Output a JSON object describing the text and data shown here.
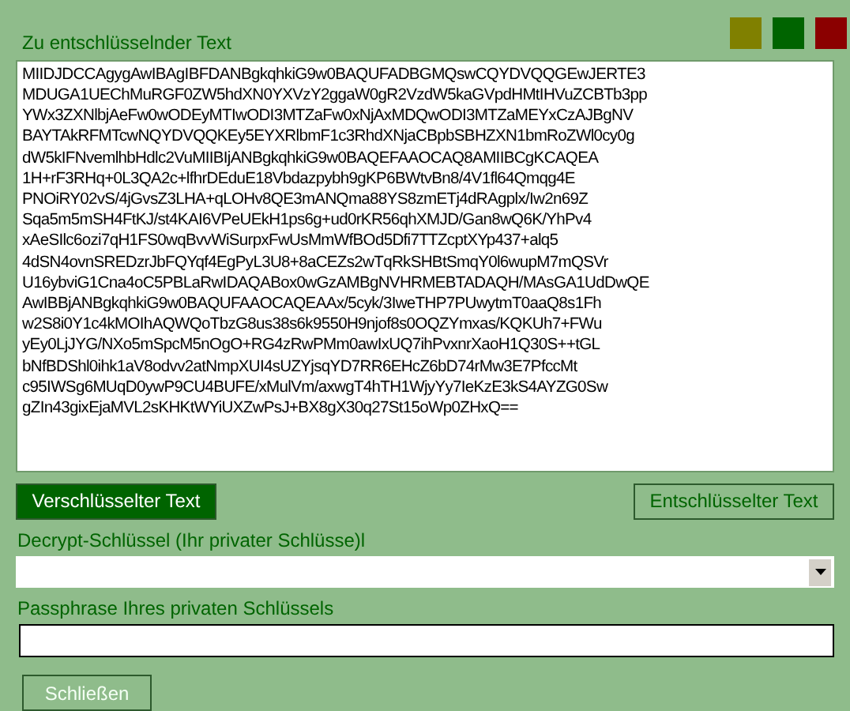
{
  "header": {
    "label": "Zu entschlüsselnder Text"
  },
  "swatches": [
    {
      "color": "#808000"
    },
    {
      "color": "#006400"
    },
    {
      "color": "#8b0000"
    }
  ],
  "text_lines": [
    "MIIDJDCCAgygAwIBAgIBFDANBgkqhkiG9w0BAQUFADBGMQswCQYDVQQGEwJERTE3",
    "MDUGA1UEChMuRGF0ZW5hdXN0YXVzY2ggaW0gR2VzdW5kaGVpdHMtIHVuZCBTb3pp",
    "YWx3ZXNlbjAeFw0wODEyMTIwODI3MTZaFw0xNjAxMDQwODI3MTZaMEYxCzAJBgNV",
    "BAYTAkRFMTcwNQYDVQQKEy5EYXRlbmF1c3RhdXNjaCBpbSBHZXN1bmRoZWl0cy0g",
    "dW5kIFNvemlhbHdlc2VuMIIBIjANBgkqhkiG9w0BAQEFAAOCAQ8AMIIBCgKCAQEA",
    "1H+rF3RHq+0L3QA2c+lfhrDEduE18Vbdazpybh9gKP6BWtvBn8/4V1fl64Qmqg4E",
    "PNOiRY02vS/4jGvsZ3LHA+qLOHv8QE3mANQma88YS8zmETj4dRAgplx/Iw2n69Z",
    "Sqa5m5mSH4FtKJ/st4KAI6VPeUEkH1ps6g+ud0rKR56qhXMJD/Gan8wQ6K/YhPv4",
    "xAeSIlc6ozi7qH1FS0wqBvvWiSurpxFwUsMmWfBOd5Dfi7TTZcptXYp437+alq5",
    "4dSN4ovnSREDzrJbFQYqf4EgPyL3U8+8aCEZs2wTqRkSHBtSmqY0l6wupM7mQSVr",
    "U16ybviG1Cna4oC5PBLaRwIDAQABox0wGzAMBgNVHRMEBTADAQH/MAsGA1UdDwQE",
    "AwIBBjANBgkqhkiG9w0BAQUFAAOCAQEAAx/5cyk/3IweTHP7PUwytmT0aaQ8s1Fh",
    "w2S8i0Y1c4kMOIhAQWQoTbzG8us38s6k9550H9njof8s0OQZYmxas/KQKUh7+FWu",
    "yEy0LjJYG/NXo5mSpcM5nOgO+RG4zRwPMm0awIxUQ7ihPvxnrXaoH1Q30S++tGL",
    "bNfBDShl0ihk1aV8odvv2atNmpXUI4sUZYjsqYD7RR6EHcZ6bD74rMw3E7PfccMt",
    "c95IWSg6MUqD0ywP9CU4BUFE/xMulVm/axwgT4hTH1WjyYy7IeKzE3kS4AYZG0Sw",
    "gZIn43gixEjaMVL2sKHKtWYiUXZwPsJ+BX8gX30q27St15oWp0ZHxQ=="
  ],
  "mode_buttons": [
    {
      "label": "Verschlüsselter Text",
      "selected": true
    },
    {
      "label": "Entschlüsselter Text",
      "selected": false
    }
  ],
  "key_label": "Decrypt-Schlüssel (Ihr privater Schlüsse)l",
  "passphrase_label": "Passphrase Ihres privaten Schlüssels",
  "close_button": "Schließen"
}
